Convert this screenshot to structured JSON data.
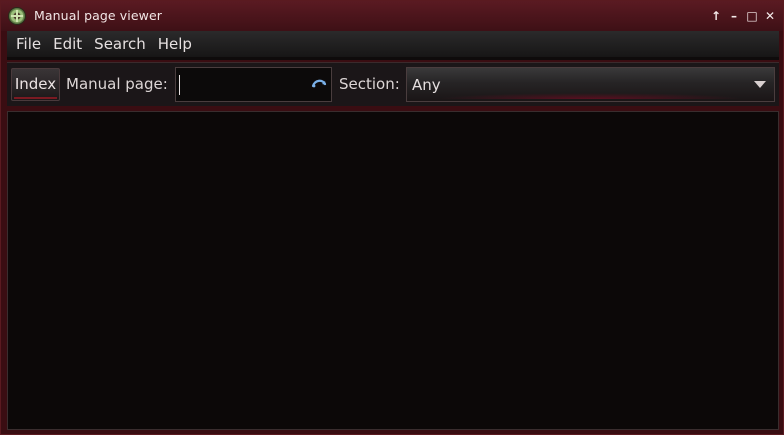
{
  "window": {
    "title": "Manual page viewer",
    "controls": {
      "keep_above": "↑",
      "minimize": "–",
      "maximize": "□",
      "close": "✕"
    }
  },
  "menubar": {
    "items": [
      "File",
      "Edit",
      "Search",
      "Help"
    ]
  },
  "toolbar": {
    "index_label": "Index",
    "manual_label": "Manual page:",
    "manual_value": "",
    "section_label": "Section:",
    "section_value": "Any"
  },
  "icons": {
    "app": "help-manual-icon",
    "clear": "clear-text-icon",
    "dropdown": "chevron-down-icon"
  },
  "colors": {
    "title_bar": "#5a1a22",
    "accent": "#7a1a22",
    "content_bg": "#0c0808"
  }
}
